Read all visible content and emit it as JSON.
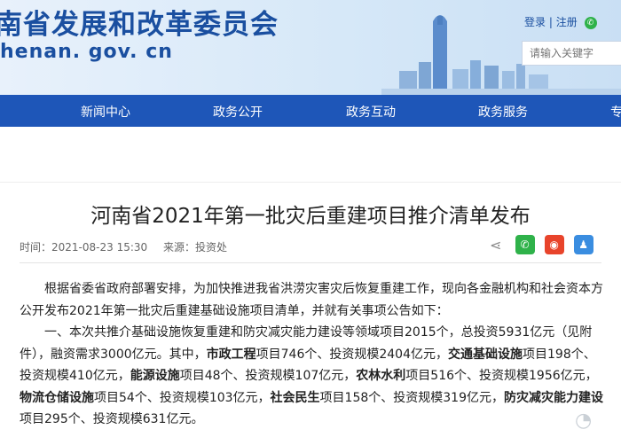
{
  "header": {
    "site_title": "南省发展和改革委员会",
    "site_domain": "henan. gov. cn",
    "login": "登录",
    "separator": "|",
    "register": "注册",
    "search_placeholder": "请输入关键字"
  },
  "nav": {
    "items": [
      "新闻中心",
      "政务公开",
      "政务互动",
      "政务服务",
      "专"
    ]
  },
  "article": {
    "title": "河南省2021年第一批灾后重建项目推介清单发布",
    "time_label": "时间：",
    "time_value": "2021-08-23 15:30",
    "source_label": "来源：",
    "source_value": "投资处"
  },
  "body": {
    "p1": "根据省委省政府部署安排，为加快推进我省洪涝灾害灾后恢复重建工作，现向各金融机构和社会资本方公开发布2021年第一批灾后重建基础设施项目清单，并就有关事项公告如下：",
    "p2_a": "一、本次共推介基础设施恢复重建和防灾减灾能力建设等领域项目2015个，总投资5931亿元（见附件），融资需求3000亿元。其中，",
    "b1": "市政工程",
    "t1": "项目746个、投资规模2404亿元，",
    "b2": "交通基础设施",
    "t2": "项目198个、投资规模410亿元，",
    "b3": "能源设施",
    "t3": "项目48个、投资规模107亿元，",
    "b4": "农林水利",
    "t4": "项目516个、投资规模1956亿元，",
    "b5": "物流仓储设施",
    "t5": "项目54个、投资规模103亿元，",
    "b6": "社会民生",
    "t6": "项目158个、投资规模319亿元，",
    "b7": "防灾减灾能力建设",
    "t7": "项目295个、投资规模631亿元。"
  }
}
